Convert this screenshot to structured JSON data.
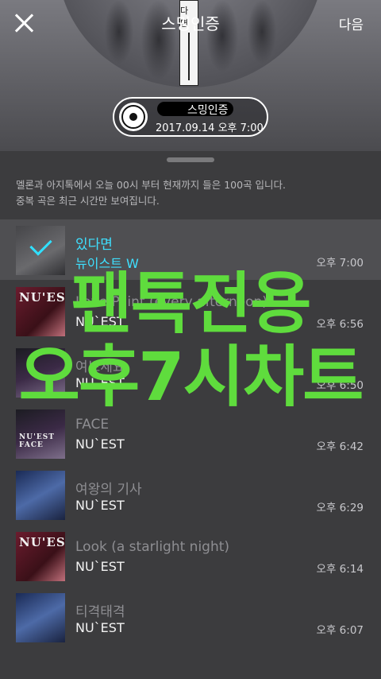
{
  "header": {
    "title": "스밍인증",
    "next_label": "다음",
    "hero_strip_text": "다 면"
  },
  "badge": {
    "title": "스밍인증",
    "datetime": "2017.09.14 오후 7:00"
  },
  "notice": {
    "line1": "멜론과 아지톡에서 오늘 00시 부터 현재까지 들은 100곡 입니다.",
    "line2": "중복 곡은 최근 시간만 보여집니다."
  },
  "songs": [
    {
      "title": "있다면",
      "artist": "뉴이스트 W",
      "time": "오후 7:00",
      "selected": true
    },
    {
      "title": "Love Paint (every afternoon)",
      "artist": "NU`EST",
      "time": "오후 6:56"
    },
    {
      "title": "여보세요",
      "artist": "NU`EST",
      "time": "오후 6:50"
    },
    {
      "title": "FACE",
      "artist": "NU`EST",
      "time": "오후 6:42"
    },
    {
      "title": "여왕의 기사",
      "artist": "NU`EST",
      "time": "오후 6:29"
    },
    {
      "title": "Look (a starlight night)",
      "artist": "NU`EST",
      "time": "오후 6:14"
    },
    {
      "title": "티격태격",
      "artist": "NU`EST",
      "time": "오후 6:07"
    }
  ],
  "album_labels": {
    "nuest": "NU'EST",
    "face": "NU'EST FACE"
  },
  "overlay": {
    "line1": "팬톡전용",
    "line2": "오후7시차트"
  },
  "colors": {
    "accent": "#3ee0ff",
    "overlay_green": "#5fdc3d"
  }
}
